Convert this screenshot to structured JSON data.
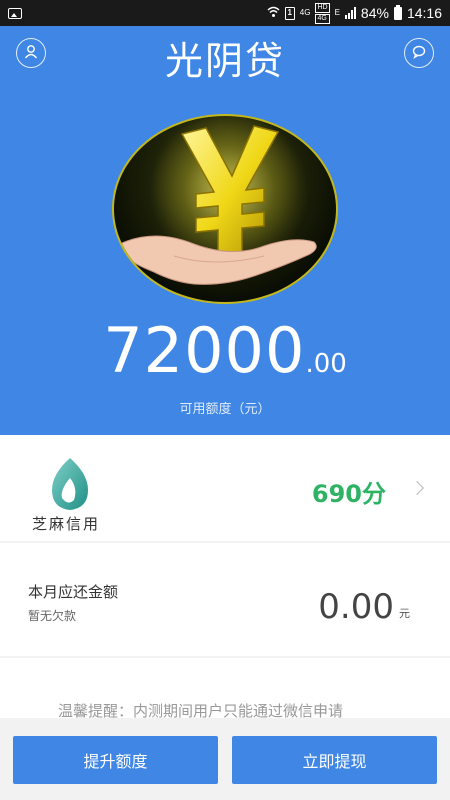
{
  "status_bar": {
    "network_small": "4G",
    "hd_top": "HD",
    "hd_bottom": "4G",
    "net_e": "E",
    "sim_label": "1",
    "battery": "84%",
    "time": "14:16"
  },
  "header": {
    "title": "光阴贷",
    "background_color": "#3f86e5"
  },
  "available_credit": {
    "integer": "72000",
    "decimal": ".00",
    "caption": "可用额度（元）"
  },
  "credit_score": {
    "provider": "芝麻信用",
    "score": "690分",
    "score_color": "#2eb365"
  },
  "repayment": {
    "title": "本月应还金额",
    "subtitle": "暂无欠款",
    "amount_int": "0",
    "amount_dec": ".00",
    "unit": "元"
  },
  "notice": {
    "text": "温馨提醒：内测期间用户只能通过微信申请"
  },
  "actions": {
    "raise_limit": "提升额度",
    "withdraw": "立即提现"
  },
  "icons": {
    "user": "user-icon",
    "chat": "chat-icon",
    "hero": "yuan-hand-icon",
    "zhima": "zhima-logo-icon",
    "chevron": "chevron-right-icon"
  }
}
